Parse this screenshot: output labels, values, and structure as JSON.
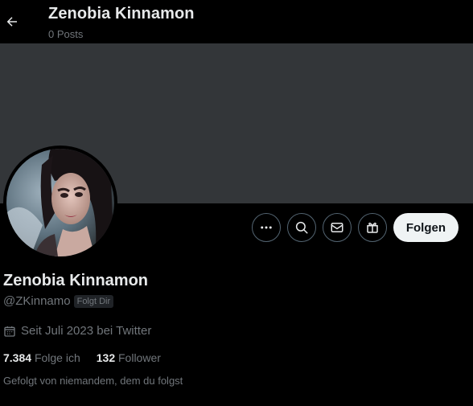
{
  "header": {
    "title": "Zenobia Kinnamon",
    "subtitle": "0 Posts"
  },
  "profile": {
    "name": "Zenobia Kinnamon",
    "handle": "@ZKinnamo",
    "follows_you_badge": "Folgt Dir",
    "joined": "Seit Juli 2023 bei Twitter",
    "following_count": "7.384",
    "following_label": "Folge ich",
    "followers_count": "132",
    "followers_label": "Follower",
    "followed_by": "Gefolgt von niemandem, dem du folgst"
  },
  "actions": {
    "follow_label": "Folgen"
  },
  "icons": {
    "back": "arrow-left-icon",
    "more": "more-icon",
    "search": "search-icon",
    "message": "mail-icon",
    "gift": "gift-icon",
    "calendar": "calendar-icon"
  },
  "colors": {
    "background": "#000000",
    "banner": "#333639",
    "text_primary": "#e7e9ea",
    "text_secondary": "#71767b",
    "button_border": "#536471",
    "follow_button_bg": "#eff3f4"
  }
}
